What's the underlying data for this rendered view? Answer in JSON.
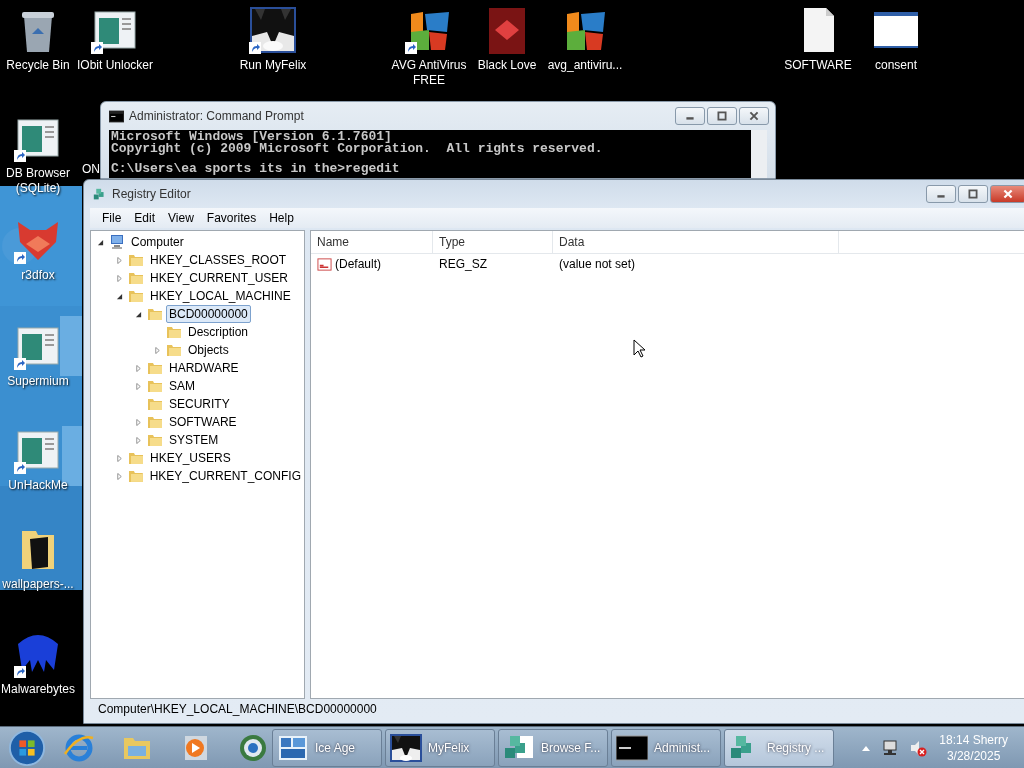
{
  "desktop_icons": [
    {
      "label": "Recycle Bin",
      "kind": "recycle",
      "shortcut": false
    },
    {
      "label": "IObit Unlocker",
      "kind": "appwin",
      "shortcut": true
    },
    {
      "label": "Run MyFelix",
      "kind": "cat",
      "shortcut": true
    },
    {
      "label": "AVG AntiVirus FREE",
      "kind": "avg",
      "shortcut": true
    },
    {
      "label": "Black Love",
      "kind": "blacklove",
      "shortcut": false
    },
    {
      "label": "avg_antiviru...",
      "kind": "avg",
      "shortcut": false
    },
    {
      "label": "SOFTWARE",
      "kind": "file",
      "shortcut": false
    },
    {
      "label": "consent",
      "kind": "window",
      "shortcut": false
    },
    {
      "label": "DB Browser (SQLite)",
      "kind": "appwin",
      "shortcut": true
    },
    {
      "label": "r3dfox",
      "kind": "fox",
      "shortcut": true
    },
    {
      "label": "Supermium",
      "kind": "appwin",
      "shortcut": true
    },
    {
      "label": "UnHackMe",
      "kind": "appwin",
      "shortcut": true
    },
    {
      "label": "wallpapers-...",
      "kind": "folder",
      "shortcut": false
    },
    {
      "label": "Malwarebytes",
      "kind": "malware",
      "shortcut": true
    }
  ],
  "partly_hidden_icon": {
    "label": "ON"
  },
  "command_prompt": {
    "title": "Administrator: Command Prompt",
    "output": [
      "Microsoft Windows [Version 6.1.7601]",
      "Copyright (c) 2009 Microsoft Corporation.  All rights reserved."
    ],
    "prompt": "C:\\Users\\ea sports its in the>regedit"
  },
  "registry_editor": {
    "title": "Registry Editor",
    "menu": [
      "File",
      "Edit",
      "View",
      "Favorites",
      "Help"
    ],
    "tree": [
      {
        "label": "Computer",
        "expanded": true,
        "selected": false,
        "children": [
          {
            "label": "HKEY_CLASSES_ROOT",
            "expanded": false,
            "selected": false
          },
          {
            "label": "HKEY_CURRENT_USER",
            "expanded": false,
            "selected": false
          },
          {
            "label": "HKEY_LOCAL_MACHINE",
            "expanded": true,
            "selected": false,
            "children": [
              {
                "label": "BCD00000000",
                "expanded": true,
                "selected": true,
                "children": [
                  {
                    "label": "Description",
                    "selected": false
                  },
                  {
                    "label": "Objects",
                    "expanded": false,
                    "selected": false
                  }
                ]
              },
              {
                "label": "HARDWARE",
                "expanded": false,
                "selected": false
              },
              {
                "label": "SAM",
                "expanded": false,
                "selected": false
              },
              {
                "label": "SECURITY",
                "selected": false
              },
              {
                "label": "SOFTWARE",
                "expanded": false,
                "selected": false
              },
              {
                "label": "SYSTEM",
                "expanded": false,
                "selected": false
              }
            ]
          },
          {
            "label": "HKEY_USERS",
            "expanded": false,
            "selected": false
          },
          {
            "label": "HKEY_CURRENT_CONFIG",
            "expanded": false,
            "selected": false
          }
        ]
      }
    ],
    "columns": [
      "Name",
      "Type",
      "Data"
    ],
    "rows": [
      {
        "name": "(Default)",
        "type": "REG_SZ",
        "data": "(value not set)"
      }
    ],
    "status_bar": "Computer\\HKEY_LOCAL_MACHINE\\BCD00000000"
  },
  "taskbar": {
    "tasks": [
      {
        "label": "Ice Age",
        "kind": "iceage",
        "selected": false
      },
      {
        "label": "MyFelix",
        "kind": "cat",
        "selected": false
      },
      {
        "label": "Browse F...",
        "kind": "cubesdoc",
        "selected": false
      },
      {
        "label": "Administ...",
        "kind": "cmd",
        "selected": false
      },
      {
        "label": "Registry ...",
        "kind": "cubes",
        "selected": true
      }
    ],
    "clock": {
      "time": "18:14 Sherry",
      "date": "3/28/2025"
    }
  }
}
